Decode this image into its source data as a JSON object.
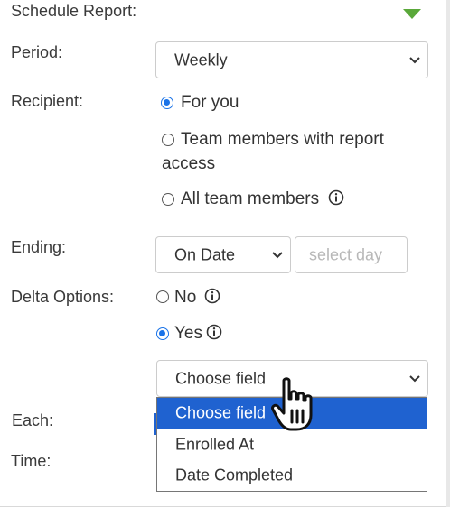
{
  "header": {
    "title": "Schedule Report:",
    "toggle_icon": "caret-down-icon",
    "accent": "#5aa83a"
  },
  "period": {
    "label": "Period:",
    "value": "Weekly"
  },
  "recipient": {
    "label": "Recipient:",
    "options": [
      {
        "text": "For you",
        "checked": true
      },
      {
        "text_line1": "Team members with report",
        "text_line2": "access",
        "checked": false
      },
      {
        "text": "All team members",
        "checked": false
      }
    ]
  },
  "ending": {
    "label": "Ending:",
    "value": "On Date",
    "day_placeholder": "select day"
  },
  "delta": {
    "label": "Delta Options:",
    "options": [
      {
        "text": "No",
        "checked": false
      },
      {
        "text": "Yes",
        "checked": true
      }
    ],
    "field_select": {
      "value": "Choose field"
    },
    "dropdown": {
      "options": [
        "Choose field",
        "Enrolled At",
        "Date Completed"
      ],
      "selected_index": 0,
      "highlight_color": "#1f62d0"
    }
  },
  "each": {
    "label": "Each:"
  },
  "time": {
    "label": "Time:"
  }
}
